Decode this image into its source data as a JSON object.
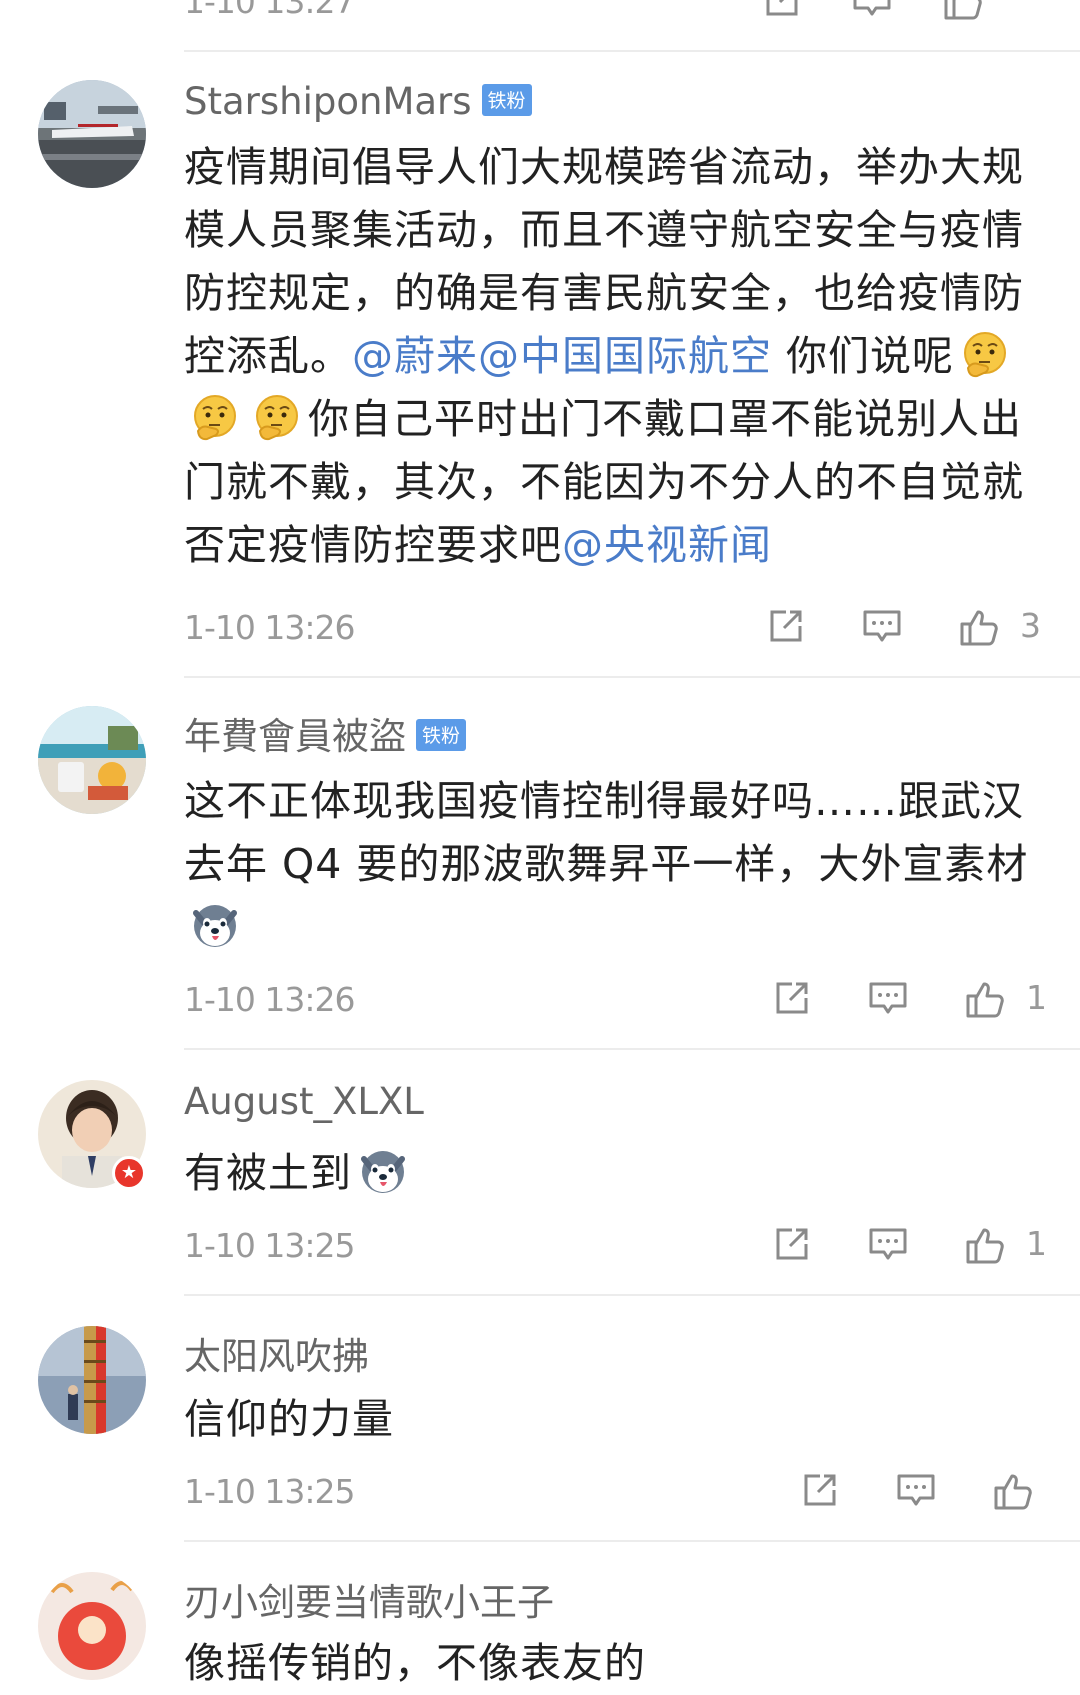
{
  "top_partial": {
    "time": "1-10 13:27"
  },
  "comments": [
    {
      "username": "StarshiponMars",
      "badge": "铁粉",
      "text_before": "疫情期间倡导人们大规模跨省流动，举办大规模人员聚集活动，而且不遵守航空安全与疫情防控规定，的确是有害民航安全，也给疫情防控添乱。",
      "mention_1": "@蔚来",
      "mention_2": "@中国国际航空",
      "text_mid": " 你们说呢",
      "text_after": "你自己平时出门不戴口罩不能说别人出门就不戴，其次，不能因为不分人的不自觉就否定疫情防控要求吧",
      "mention_3": "@央视新闻",
      "time": "1-10 13:26",
      "likes": "3"
    },
    {
      "username": "年費會員被盜",
      "badge": "铁粉",
      "text": "这不正体现我国疫情控制得最好吗……跟武汉去年 Q4 要的那波歌舞昇平一样，大外宣素材",
      "time": "1-10 13:26",
      "likes": "1"
    },
    {
      "username": "August_XLXL",
      "text": "有被土到",
      "time": "1-10 13:25",
      "likes": "1"
    },
    {
      "username": "太阳风吹拂",
      "text": "信仰的力量",
      "time": "1-10 13:25",
      "likes": ""
    },
    {
      "username": "刃小剑要当情歌小王子",
      "text": "像摇传销的，不像表友的"
    }
  ],
  "icons": [
    "share-icon",
    "comment-icon",
    "like-icon",
    "thinking-emoji",
    "husky-emoji",
    "verified-badge-icon"
  ],
  "colors": {
    "mention": "#4a7cc9",
    "badge": "#5b9be8",
    "verified": "#e8362c",
    "meta": "#999999"
  }
}
